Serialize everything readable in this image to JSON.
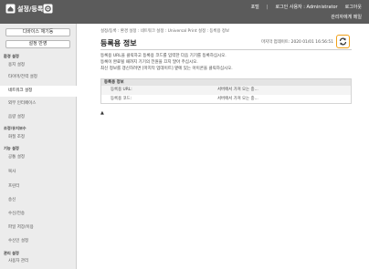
{
  "header": {
    "title": "설정/등록",
    "portal": "포털",
    "login_user": "로그인 사용자 : Administrator",
    "logout": "로그아웃",
    "contact": "관리자에게 메일"
  },
  "sidebar": {
    "device_restart": "디바이스 재기동",
    "apply_settings": "설정 반영",
    "sections": [
      {
        "label": "환경 설정",
        "items": [
          "용지 설정",
          "타이머/전력 설정",
          "네트워크 설정",
          "외부 인터페이스",
          "음량 설정"
        ]
      },
      {
        "label": "조정/유지보수",
        "items": [
          "화질 조정"
        ]
      },
      {
        "label": "기능 설정",
        "items": [
          "공통 설정",
          "복사",
          "프린터",
          "송신",
          "수신/전송",
          "파일 저장/이용",
          "수신인 설정"
        ]
      },
      {
        "label": "관리 설정",
        "items": [
          "사용자 관리"
        ]
      }
    ],
    "active_item": "네트워크 설정"
  },
  "main": {
    "breadcrumb": "설정/등록 : 환경 설정 : 네트워크 설정 : Universal Print 설정 : 등록용 정보",
    "title": "등록용 정보",
    "last_updated": "마지막 업데이트: 2020 01/01 16:56:51",
    "description": [
      "등록용 URL을 클릭하고 등록용 코드를 입력한 다음 기기를 등록하십시오.",
      "등록이 완료될 때까지 기기의 전원을 끄지 말아 주십시오.",
      "최신 정보를 갱신하려면 [마지막 업데이트] 옆에 있는 아이콘을 클릭하십시오."
    ],
    "panel": {
      "heading": "등록용 정보",
      "rows": [
        {
          "label": "등록용 URL:",
          "value": "서버에서 가져 오는 중..."
        },
        {
          "label": "등록용 코드:",
          "value": "서버에서 가져 오는 중..."
        }
      ]
    },
    "top_link": "▲"
  },
  "colors": {
    "header_bg": "#5b5b5b",
    "sidebar_bg": "#ececec",
    "refresh_highlight": "#f0a018"
  }
}
